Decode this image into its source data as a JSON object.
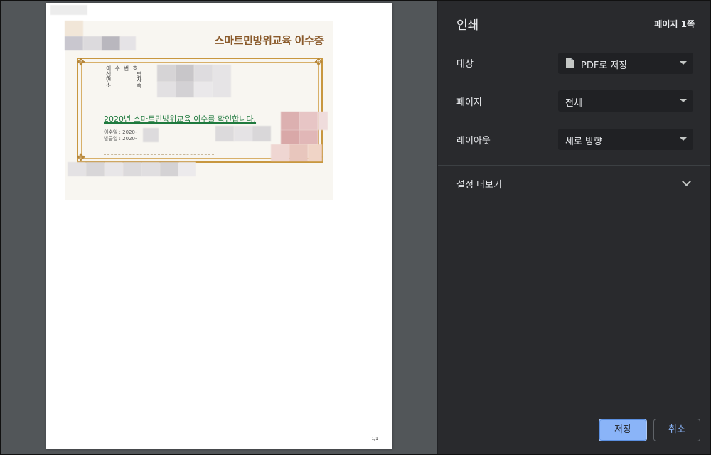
{
  "panel": {
    "title": "인쇄",
    "page_count": "페이지 1쪽",
    "destination": {
      "label": "대상",
      "value": "PDF로 저장",
      "icon": "file-icon"
    },
    "pages": {
      "label": "페이지",
      "value": "전체"
    },
    "layout": {
      "label": "레이아웃",
      "value": "세로 방향"
    },
    "more_settings": "설정 더보기",
    "save_button": "저장",
    "cancel_button": "취소"
  },
  "preview": {
    "page_number": "1/1",
    "certificate": {
      "title": "스마트민방위교육 이수증",
      "labels": [
        "이  수  번  호",
        "성              명",
        "면              차",
        "소              속"
      ],
      "main_text": "2020년 스마트민방위교육 이수를 확인합니다.",
      "date_completed": "이수일 : 2020-",
      "date_issued": "발급일 : 2020-"
    }
  },
  "colors": {
    "panel_bg": "#292a2d",
    "preview_bg": "#525659",
    "accent": "#8ab4f8",
    "certificate_title": "#8a5a2b",
    "certificate_main": "#1f7a3e"
  }
}
